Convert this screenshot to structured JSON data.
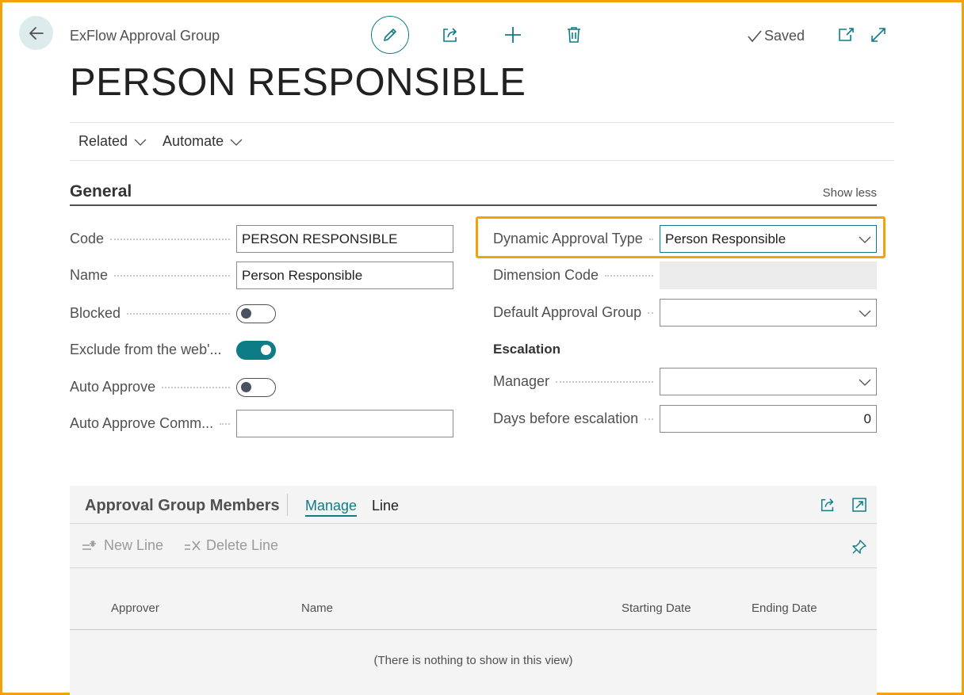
{
  "header": {
    "breadcrumb": "ExFlow Approval Group",
    "saved_label": "Saved",
    "page_title": "PERSON RESPONSIBLE"
  },
  "action_bar": {
    "items": [
      {
        "label": "Related"
      },
      {
        "label": "Automate"
      }
    ]
  },
  "general": {
    "title": "General",
    "show_less": "Show less",
    "left_fields": {
      "code": {
        "label": "Code",
        "value": "PERSON RESPONSIBLE"
      },
      "name": {
        "label": "Name",
        "value": "Person Responsible"
      },
      "blocked": {
        "label": "Blocked",
        "on": false
      },
      "exclude": {
        "label": "Exclude from the web'...",
        "on": true
      },
      "auto_approve": {
        "label": "Auto Approve",
        "on": false
      },
      "auto_approve_comment": {
        "label": "Auto Approve Comm...",
        "value": ""
      }
    },
    "right_fields": {
      "dynamic_type": {
        "label": "Dynamic Approval Type",
        "value": "Person Responsible"
      },
      "dimension_code": {
        "label": "Dimension Code",
        "value": ""
      },
      "default_group": {
        "label": "Default Approval Group",
        "value": ""
      },
      "escalation_heading": "Escalation",
      "manager": {
        "label": "Manager",
        "value": ""
      },
      "days_before": {
        "label": "Days before escalation",
        "value": "0"
      }
    }
  },
  "members": {
    "title": "Approval Group Members",
    "tabs": [
      {
        "label": "Manage",
        "active": true
      },
      {
        "label": "Line",
        "active": false
      }
    ],
    "actions": {
      "new_line": "New Line",
      "delete_line": "Delete Line"
    },
    "columns": [
      "Approver",
      "Name",
      "Starting Date",
      "Ending Date"
    ],
    "empty_message": "(There is nothing to show in this view)"
  },
  "colors": {
    "accent": "#0e7c86",
    "highlight": "#f0a30a"
  }
}
